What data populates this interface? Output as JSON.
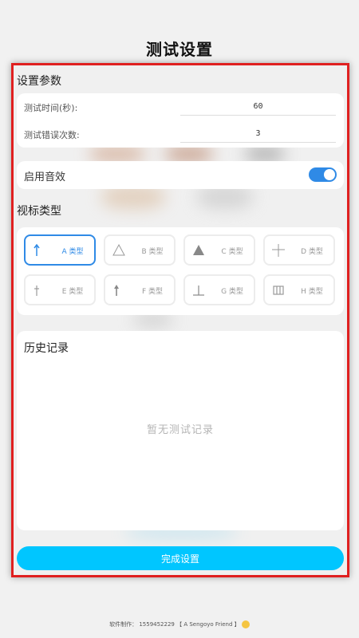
{
  "page": {
    "title": "测试设置"
  },
  "params": {
    "section_title": "设置参数",
    "rows": [
      {
        "label": "测试时间(秒):",
        "value": "60"
      },
      {
        "label": "测试错误次数:",
        "value": "3"
      }
    ]
  },
  "sound": {
    "label": "启用音效",
    "enabled": true
  },
  "optotype": {
    "section_title": "视标类型",
    "selected": "A 类型",
    "types": [
      {
        "label": "A 类型",
        "icon": "arrow-up-icon"
      },
      {
        "label": "B 类型",
        "icon": "triangle-outline-icon"
      },
      {
        "label": "C 类型",
        "icon": "triangle-filled-icon"
      },
      {
        "label": "D 类型",
        "icon": "cross-icon"
      },
      {
        "label": "E 类型",
        "icon": "dagger-icon"
      },
      {
        "label": "F 类型",
        "icon": "arrow-up-bold-icon"
      },
      {
        "label": "G 类型",
        "icon": "up-tack-icon"
      },
      {
        "label": "H 类型",
        "icon": "comb-icon"
      }
    ]
  },
  "history": {
    "section_title": "历史记录",
    "empty_text": "暂无测试记录"
  },
  "actions": {
    "done_label": "完成设置"
  },
  "footer": {
    "text": "软件制作： 1559452229 【 A Sengoyo Friend 】"
  },
  "colors": {
    "accent": "#2f8ae6",
    "button": "#00c6ff",
    "frame": "#e02020"
  }
}
